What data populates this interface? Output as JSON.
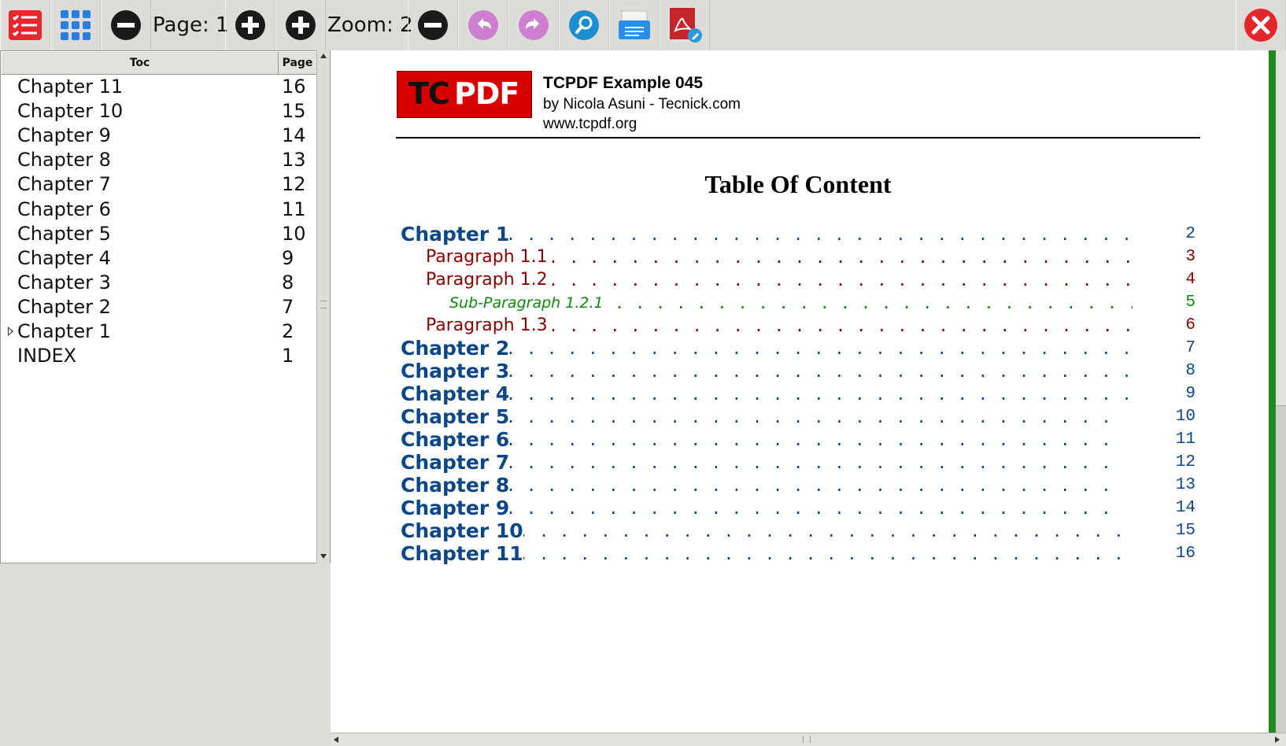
{
  "toolbar": {
    "page_label": "Page: 1",
    "zoom_label": "Zoom: 2",
    "buttons": [
      "toc-list",
      "thumbnails",
      "page-previous",
      "page-next",
      "zoom-in",
      "zoom-out",
      "undo",
      "redo",
      "search",
      "print",
      "pdf-edit",
      "close"
    ]
  },
  "toc": {
    "columns": [
      "Toc",
      "Page"
    ],
    "rows": [
      {
        "title": "Chapter 11",
        "page": "16"
      },
      {
        "title": "Chapter 10",
        "page": "15"
      },
      {
        "title": "Chapter 9",
        "page": "14"
      },
      {
        "title": "Chapter 8",
        "page": "13"
      },
      {
        "title": "Chapter 7",
        "page": "12"
      },
      {
        "title": "Chapter 6",
        "page": "11"
      },
      {
        "title": "Chapter 5",
        "page": "10"
      },
      {
        "title": "Chapter 4",
        "page": "9"
      },
      {
        "title": "Chapter 3",
        "page": "8"
      },
      {
        "title": "Chapter 2",
        "page": "7"
      },
      {
        "title": "Chapter 1",
        "page": "2",
        "expandable": true
      },
      {
        "title": "INDEX",
        "page": "1"
      }
    ]
  },
  "document": {
    "logo_text_black": "TC",
    "logo_text_white": "PDF",
    "header_title": "TCPDF Example 045",
    "header_author": "by Nicola Asuni - Tecnick.com",
    "header_url": "www.tcpdf.org",
    "heading": "Table Of Content",
    "entries": [
      {
        "label": "Chapter 1",
        "page": "2",
        "level": 0
      },
      {
        "label": "Paragraph 1.1",
        "page": "3",
        "level": 1
      },
      {
        "label": "Paragraph 1.2",
        "page": "4",
        "level": 1
      },
      {
        "label": "Sub-Paragraph 1.2.1",
        "page": "5",
        "level": 2
      },
      {
        "label": "Paragraph 1.3",
        "page": "6",
        "level": 1
      },
      {
        "label": "Chapter 2",
        "page": "7",
        "level": 0
      },
      {
        "label": "Chapter 3",
        "page": "8",
        "level": 0
      },
      {
        "label": "Chapter 4",
        "page": "9",
        "level": 0
      },
      {
        "label": "Chapter 5",
        "page": "10",
        "level": 0
      },
      {
        "label": "Chapter 6",
        "page": "11",
        "level": 0
      },
      {
        "label": "Chapter 7",
        "page": "12",
        "level": 0
      },
      {
        "label": "Chapter 8",
        "page": "13",
        "level": 0
      },
      {
        "label": "Chapter 9",
        "page": "14",
        "level": 0
      },
      {
        "label": "Chapter 10",
        "page": "15",
        "level": 0
      },
      {
        "label": "Chapter 11",
        "page": "16",
        "level": 0
      }
    ]
  },
  "colors": {
    "chapter": "#0b4688",
    "paragraph": "#8b0000",
    "sub_paragraph": "#0c8a0c",
    "logo_red": "#d60000"
  }
}
